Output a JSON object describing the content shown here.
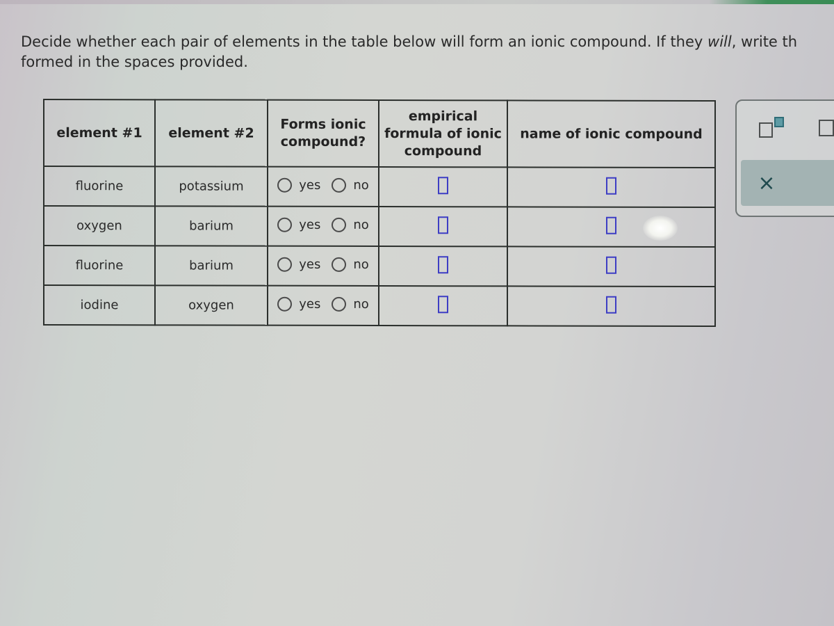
{
  "instructions": {
    "part1": "Decide whether each pair of elements in the table below will form an ionic compound. If they ",
    "emphasis": "will",
    "part2": ", write th",
    "line2": "formed in the spaces provided."
  },
  "table": {
    "headers": [
      "element #1",
      "element #2",
      "Forms ionic compound?",
      "empirical formula of ionic compound",
      "name of ionic compound"
    ],
    "header_lines": {
      "col3": [
        "Forms ionic",
        "compound?"
      ],
      "col4": [
        "empirical",
        "formula of ionic",
        "compound"
      ]
    },
    "radio_labels": {
      "yes": "yes",
      "no": "no"
    },
    "rows": [
      {
        "element1": "fluorine",
        "element2": "potassium",
        "forms_ionic": null,
        "formula": "",
        "name": ""
      },
      {
        "element1": "oxygen",
        "element2": "barium",
        "forms_ionic": null,
        "formula": "",
        "name": ""
      },
      {
        "element1": "fluorine",
        "element2": "barium",
        "forms_ionic": null,
        "formula": "",
        "name": ""
      },
      {
        "element1": "iodine",
        "element2": "oxygen",
        "forms_ionic": null,
        "formula": "",
        "name": ""
      }
    ]
  },
  "toolbar": {
    "tools": [
      "superscript-icon",
      "box-icon"
    ],
    "clear_symbol": "×"
  },
  "colors": {
    "answer_box": "#3d3dc4",
    "clear_button": "#a3b3b3",
    "accent_green": "#3a8c55"
  }
}
